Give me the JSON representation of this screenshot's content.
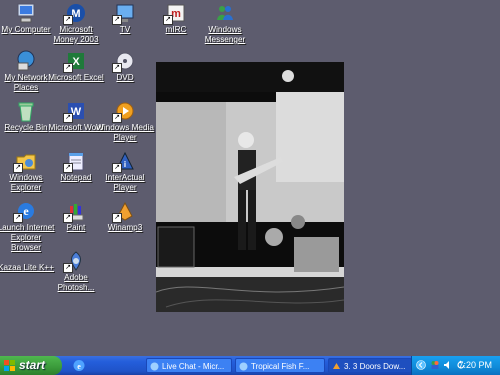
{
  "desktop_icons": {
    "my_computer": "My Computer",
    "money": "Microsoft Money 2003",
    "tv": "TV",
    "mirc": "mIRC",
    "messenger": "Windows Messenger",
    "network": "My Network Places",
    "excel": "Microsoft Excel",
    "dvd": "DVD",
    "recycle": "Recycle Bin",
    "word": "Microsoft Word",
    "wmp": "Windows Media Player",
    "explorer": "Windows Explorer",
    "notepad": "Notepad",
    "interactual": "InterActual Player",
    "ie": "Launch Internet Explorer Browser",
    "paint": "Paint",
    "winamp": "Winamp3",
    "kazaa": "Kazaa Lite K++",
    "photoshop": "Adobe Photosh..."
  },
  "taskbar": {
    "start_label": "start",
    "buttons": [
      "Live Chat - Micr...",
      "Tropical Fish F...",
      "3. 3 Doors Dow..."
    ],
    "clock": "7:20 PM"
  },
  "colors": {
    "desktop_bg": "#5d5c6e",
    "taskbar_blue": "#245edb",
    "start_green": "#3a9a3a",
    "tray_blue": "#0f8ad8"
  }
}
